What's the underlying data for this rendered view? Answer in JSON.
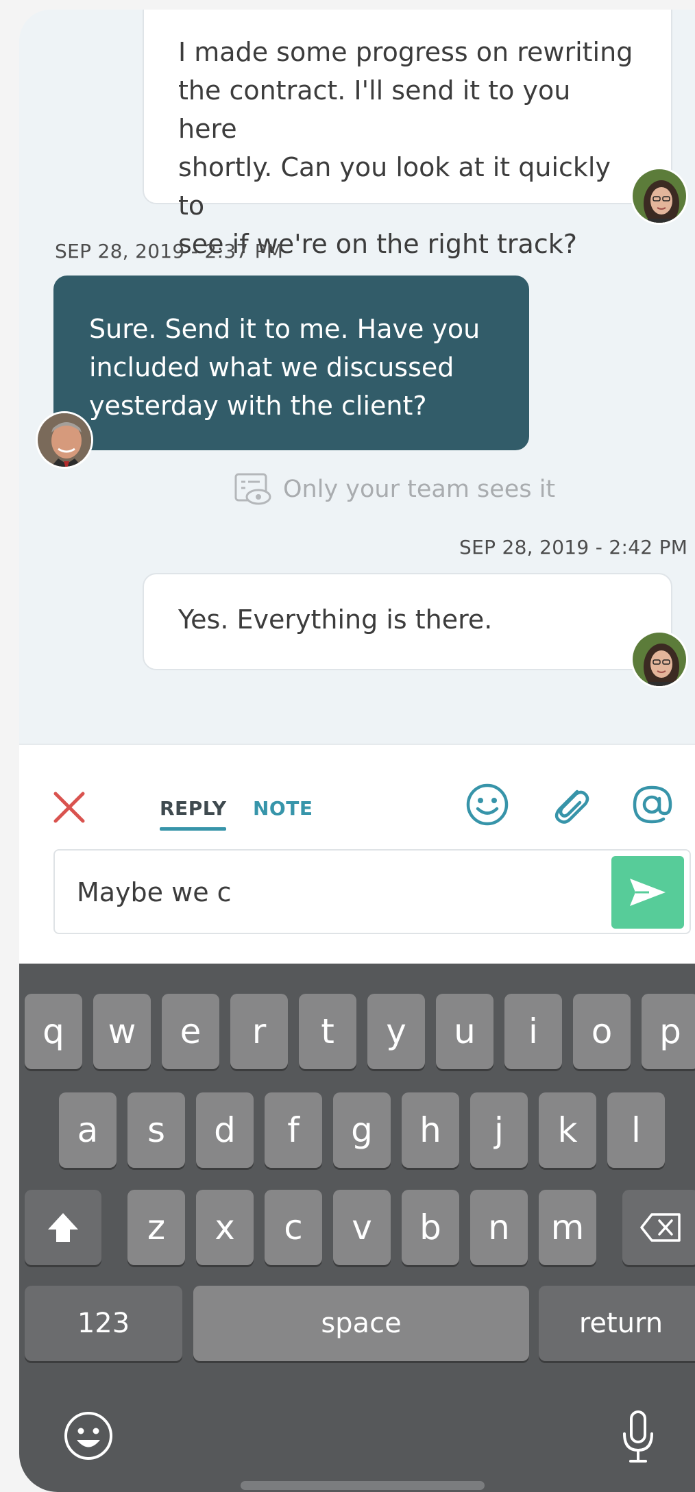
{
  "messages": [
    {
      "text": "I made some progress on rewriting\nthe contract. I'll send it to you here\nshortly. Can you look at it quickly to\nsee if we're on the right track?",
      "direction": "outgoing"
    },
    {
      "timestamp": "SEP 28, 2019 - 2:37 PM",
      "text": "Sure. Send it to me. Have you\nincluded what we discussed\nyesterday with the client?",
      "direction": "incoming-private"
    },
    {
      "private_note": "Only your team sees it"
    },
    {
      "timestamp": "SEP 28, 2019 - 2:42 PM",
      "text": "Yes. Everything is there.",
      "direction": "outgoing"
    }
  ],
  "composer": {
    "tabs": [
      "REPLY",
      "NOTE"
    ],
    "active_tab": "REPLY",
    "input_value": "Maybe we c",
    "icons": [
      "close-icon",
      "emoji-icon",
      "paperclip-icon",
      "mention-icon",
      "send-icon"
    ]
  },
  "keyboard": {
    "row1": [
      "q",
      "w",
      "e",
      "r",
      "t",
      "y",
      "u",
      "i",
      "o",
      "p"
    ],
    "row2": [
      "a",
      "s",
      "d",
      "f",
      "g",
      "h",
      "j",
      "k",
      "l"
    ],
    "row3": [
      "z",
      "x",
      "c",
      "v",
      "b",
      "n",
      "m"
    ],
    "numbers_label": "123",
    "space_label": "space",
    "return_label": "return"
  },
  "colors": {
    "incoming_bubble": "#325c69",
    "accent": "#3794a9",
    "send_button": "#57cc99",
    "close_x": "#d9534f",
    "keyboard_bg": "#56585a"
  }
}
